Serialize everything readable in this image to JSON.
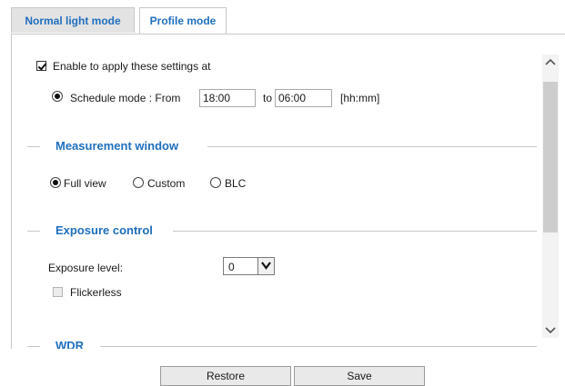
{
  "tabs": [
    {
      "label": "Normal light mode",
      "active": false
    },
    {
      "label": "Profile mode",
      "active": true
    }
  ],
  "enable": {
    "label": "Enable to apply these settings at",
    "checked": true
  },
  "schedule": {
    "label": "Schedule mode : From",
    "from_value": "18:00",
    "to_label": "to",
    "to_value": "06:00",
    "unit": "[hh:mm]",
    "selected": true
  },
  "measurement": {
    "title": "Measurement window",
    "options": [
      {
        "label": "Full view",
        "selected": true
      },
      {
        "label": "Custom",
        "selected": false
      },
      {
        "label": "BLC",
        "selected": false
      }
    ]
  },
  "exposure": {
    "title": "Exposure control",
    "level_label": "Exposure level:",
    "level_value": "0",
    "flickerless_label": "Flickerless",
    "flickerless_checked": false
  },
  "wdr": {
    "title": "WDR"
  },
  "buttons": {
    "restore": "Restore",
    "save": "Save"
  },
  "icons": {
    "scroll_up": "chevron-up-icon",
    "scroll_down": "chevron-down-icon",
    "dropdown": "chevron-down-icon"
  }
}
